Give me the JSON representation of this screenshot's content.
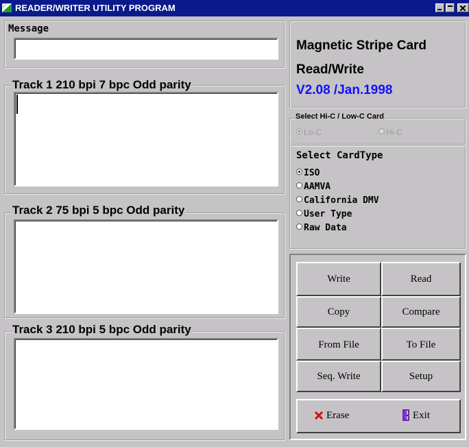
{
  "window": {
    "title": "READER/WRITER UTILITY PROGRAM"
  },
  "message": {
    "label": "Message",
    "value": ""
  },
  "tracks": [
    {
      "label": "Track 1  210 bpi  7 bpc  Odd parity",
      "value": ""
    },
    {
      "label": "Track 2  75 bpi  5 bpc  Odd parity",
      "value": ""
    },
    {
      "label": "Track 3  210 bpi  5 bpc  Odd parity",
      "value": ""
    }
  ],
  "info": {
    "line1": "Magnetic Stripe Card",
    "line2": "Read/Write",
    "version": "V2.08 /Jan.1998"
  },
  "coercivity": {
    "label": "Select Hi-C / Low-C Card",
    "options": [
      {
        "label": "Lo-C",
        "checked": true
      },
      {
        "label": "Hi-C",
        "checked": false
      }
    ]
  },
  "card_type": {
    "label": "Select CardType",
    "options": [
      {
        "label": "ISO",
        "checked": true
      },
      {
        "label": "AAMVA",
        "checked": false
      },
      {
        "label": "California DMV",
        "checked": false
      },
      {
        "label": "User Type",
        "checked": false
      },
      {
        "label": "Raw Data",
        "checked": false
      }
    ]
  },
  "buttons": {
    "write": "Write",
    "read": "Read",
    "copy": "Copy",
    "compare": "Compare",
    "from_file": "From File",
    "to_file": "To File",
    "seq_write": "Seq. Write",
    "setup": "Setup",
    "erase": "Erase",
    "exit": "Exit"
  },
  "colors": {
    "titlebar": "#0a1a8c",
    "version_text": "#1010ff",
    "erase_icon": "#d01010",
    "face": "#c6c3c6"
  },
  "icons": {
    "app": "app-icon",
    "erase": "x-mark-icon",
    "exit": "exit-door-icon"
  }
}
